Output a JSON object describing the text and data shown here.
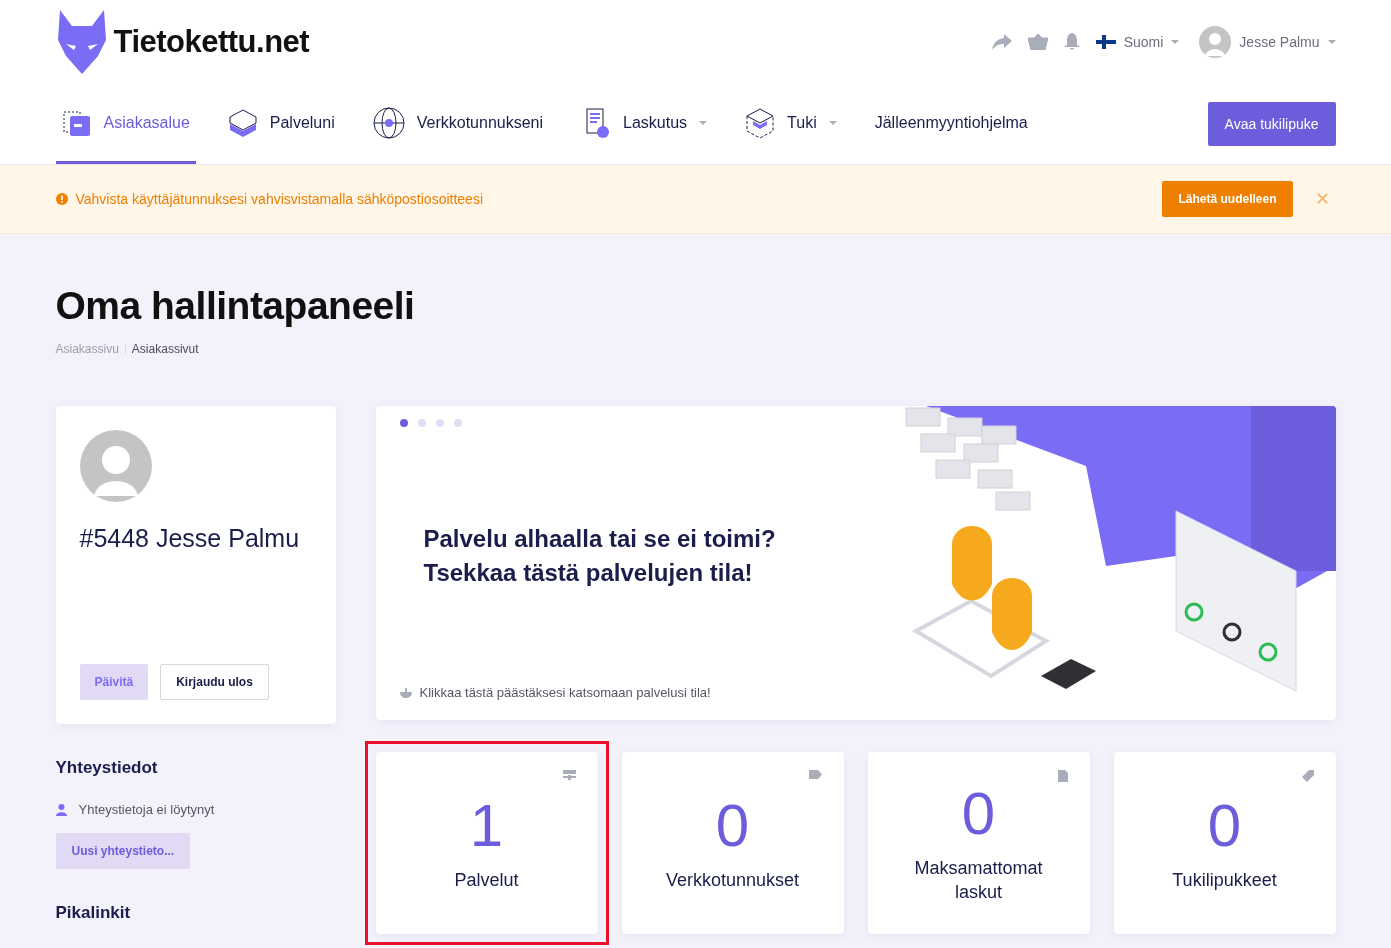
{
  "logo": {
    "text": "Tietokettu.net"
  },
  "topbar": {
    "language": "Suomi",
    "user": "Jesse Palmu"
  },
  "nav": {
    "items": [
      {
        "label": "Asiakasalue",
        "selected": true,
        "dropdown": false
      },
      {
        "label": "Palveluni",
        "selected": false,
        "dropdown": false
      },
      {
        "label": "Verkkotunnukseni",
        "selected": false,
        "dropdown": false
      },
      {
        "label": "Laskutus",
        "selected": false,
        "dropdown": true
      },
      {
        "label": "Tuki",
        "selected": false,
        "dropdown": true
      },
      {
        "label": "Jälleenmyyntiohjelma",
        "selected": false,
        "dropdown": false
      }
    ],
    "button": "Avaa tukilipuke"
  },
  "alert": {
    "text": "Vahvista käyttäjätunnuksesi vahvisvistamalla sähköpostiosoitteesi",
    "button": "Lähetä uudelleen",
    "close": "✕"
  },
  "page": {
    "title": "Oma hallintapaneeli",
    "breadcrumb": [
      "Asiakassivu",
      "Asiakassivut"
    ]
  },
  "profile": {
    "name": "#5448 Jesse Palmu",
    "buttons": [
      {
        "label": "Päivitä",
        "kind": "primary"
      },
      {
        "label": "Kirjaudu ulos",
        "kind": "outline"
      }
    ]
  },
  "contacts": {
    "title": "Yhteystiedot",
    "empty": "Yhteystietoja ei löytynyt",
    "button": "Uusi yhteystieto..."
  },
  "quicklinks": {
    "title": "Pikalinkit"
  },
  "banner": {
    "dots": [
      {
        "selected": true
      },
      {
        "selected": false
      },
      {
        "selected": false
      },
      {
        "selected": false
      }
    ],
    "headline": [
      "Palvelu alhaalla tai se ei toimi?",
      "Tsekkaa tästä palvelujen tila!"
    ],
    "link": "Klikkaa tästä päästäksesi katsomaan palvelusi tila!"
  },
  "stats": [
    {
      "value": "1",
      "label": "Palvelut",
      "highlighted": true
    },
    {
      "value": "0",
      "label": "Verkkotunnukset",
      "highlighted": false
    },
    {
      "value": "0",
      "label": "Maksamattomat laskut",
      "highlighted": false
    },
    {
      "value": "0",
      "label": "Tukilipukkeet",
      "highlighted": false
    }
  ]
}
